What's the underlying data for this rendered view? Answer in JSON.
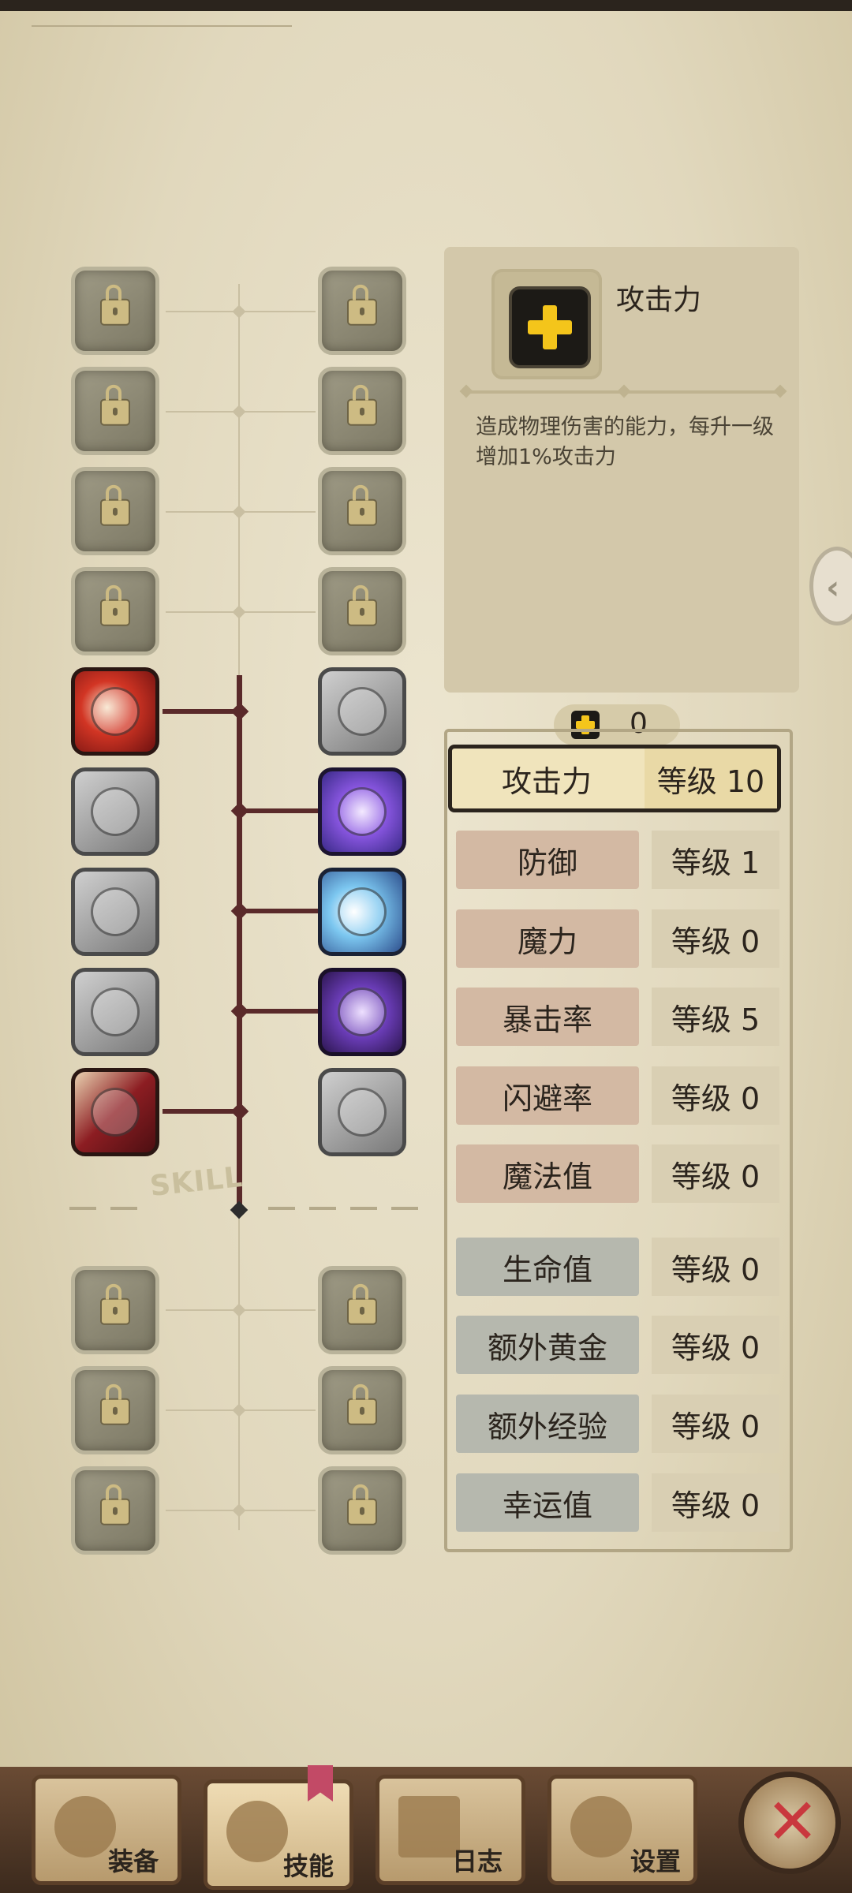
{
  "detail": {
    "title": "攻击力",
    "description": "造成物理伤害的能力，每升一级增加1%攻击力",
    "icon": "plus-icon"
  },
  "points": {
    "value": "0",
    "icon": "plus-icon"
  },
  "stats": [
    {
      "name": "攻击力",
      "level": "等级 10"
    },
    {
      "name": "防御",
      "level": "等级 1"
    },
    {
      "name": "魔力",
      "level": "等级 0"
    },
    {
      "name": "暴击率",
      "level": "等级 5"
    },
    {
      "name": "闪避率",
      "level": "等级 0"
    },
    {
      "name": "魔法值",
      "level": "等级 0"
    },
    {
      "name": "生命值",
      "level": "等级 0"
    },
    {
      "name": "额外黄金",
      "level": "等级 0"
    },
    {
      "name": "额外经验",
      "level": "等级 0"
    },
    {
      "name": "幸运值",
      "level": "等级 0"
    }
  ],
  "tree_label": "SKILL",
  "nav": {
    "equipment": "装备",
    "skills": "技能",
    "log": "日志",
    "settings": "设置"
  },
  "colors": {
    "parchment": "#e4dcc3",
    "trunk": "#5a2a2a",
    "accent_plus": "#f4c51b",
    "close": "#c9383e"
  }
}
